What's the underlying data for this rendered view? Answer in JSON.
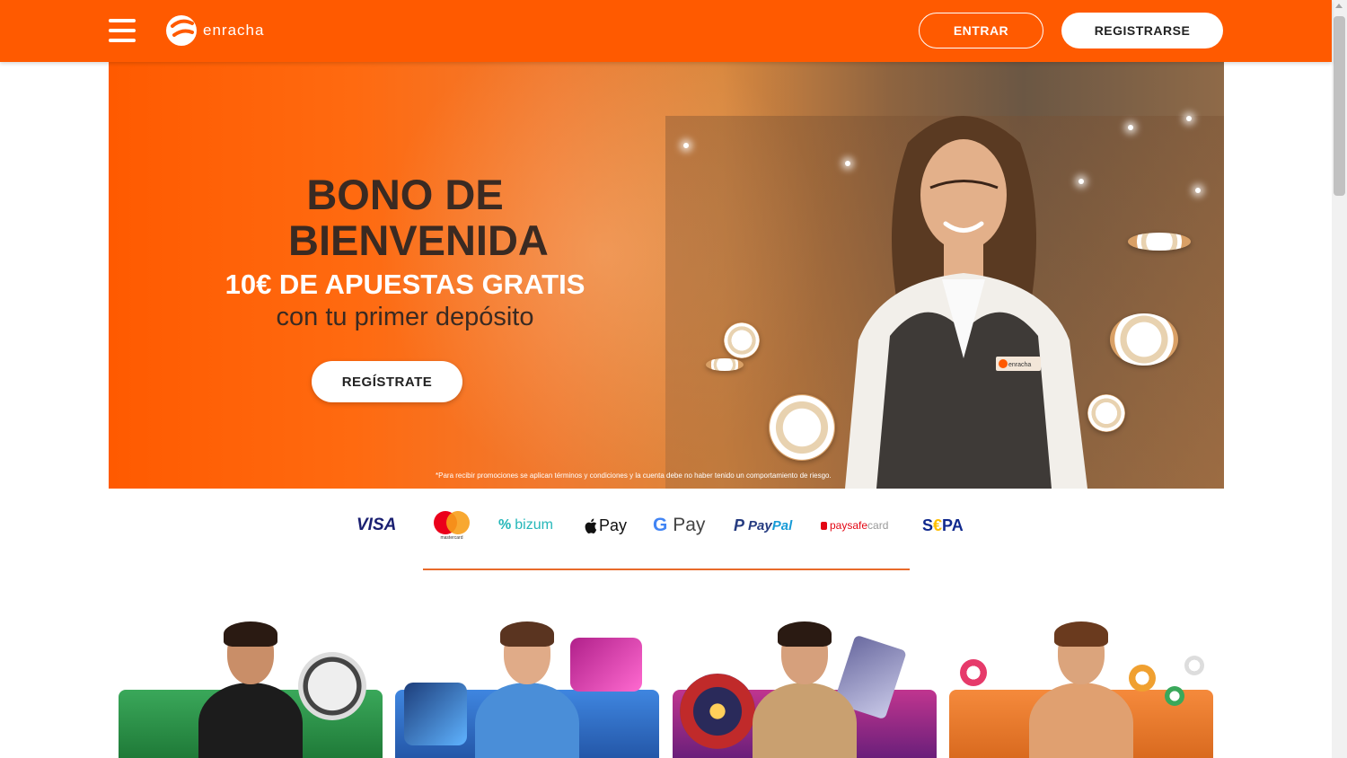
{
  "header": {
    "logo_text": "enracha",
    "login_label": "ENTRAR",
    "register_label": "REGISTRARSE",
    "bg_color": "#ff5a00"
  },
  "banner": {
    "title_line1": "BONO DE",
    "title_line2": "BIENVENIDA",
    "subtitle": "10€ DE APUESTAS GRATIS",
    "subtitle2": "con tu primer depósito",
    "cta_label": "REGÍSTRATE",
    "disclaimer": "*Para recibir promociones se aplican términos y condiciones y la cuenta debe no haber tenido un comportamiento de riesgo.",
    "badge_text": "enracha"
  },
  "payments": {
    "visa": "VISA",
    "mastercard": "mastercard",
    "bizum": "bizum",
    "apple_pay": "Pay",
    "google_pay_g": "G",
    "google_pay": "Pay",
    "paypal_1": "Pay",
    "paypal_2": "Pal",
    "paysafe_1": "paysafe",
    "paysafe_2": "card",
    "sepa_1": "S",
    "sepa_e": "€",
    "sepa_2": "PA"
  },
  "categories": [
    {
      "id": "sports",
      "color": "#2e9a4a",
      "icons": [
        "soccer-ball-icon",
        "basketball-icon"
      ]
    },
    {
      "id": "slots",
      "color": "#2d6fc9",
      "icons": [
        "slot-machine-icon"
      ]
    },
    {
      "id": "casino",
      "color": "#9a2a8a",
      "icons": [
        "roulette-icon",
        "cards-icon"
      ]
    },
    {
      "id": "bingo",
      "color": "#f07a30",
      "icons": [
        "bingo-ball-icon"
      ]
    }
  ]
}
